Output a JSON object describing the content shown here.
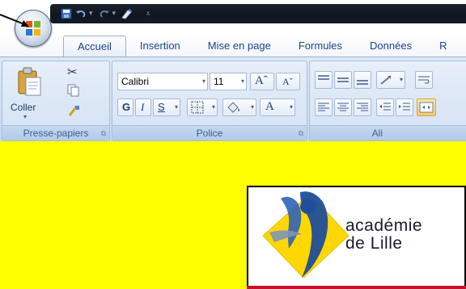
{
  "quick_access": {
    "items": [
      "save-icon",
      "undo-icon",
      "redo-icon",
      "paint-icon",
      "customize-icon"
    ]
  },
  "tabs": [
    {
      "label": "Accueil",
      "active": true
    },
    {
      "label": "Insertion"
    },
    {
      "label": "Mise en page"
    },
    {
      "label": "Formules"
    },
    {
      "label": "Données"
    },
    {
      "label": "R"
    }
  ],
  "clipboard": {
    "paste_label": "Coller",
    "group_label": "Presse-papiers"
  },
  "font": {
    "name": "Calibri",
    "size": "11",
    "group_label": "Police",
    "bold": "G",
    "italic": "I",
    "underline": "S"
  },
  "alignment": {
    "group_label": "Ali"
  },
  "colors": {
    "ribbon": "#cfdff2",
    "tab_text": "#15428b",
    "document_bg": "#ffff00",
    "logo_red": "#c8102e",
    "logo_yellow": "#ffd700",
    "logo_blue": "#1f4e9a"
  },
  "logo": {
    "line1": "académie",
    "line2": "de Lille"
  }
}
